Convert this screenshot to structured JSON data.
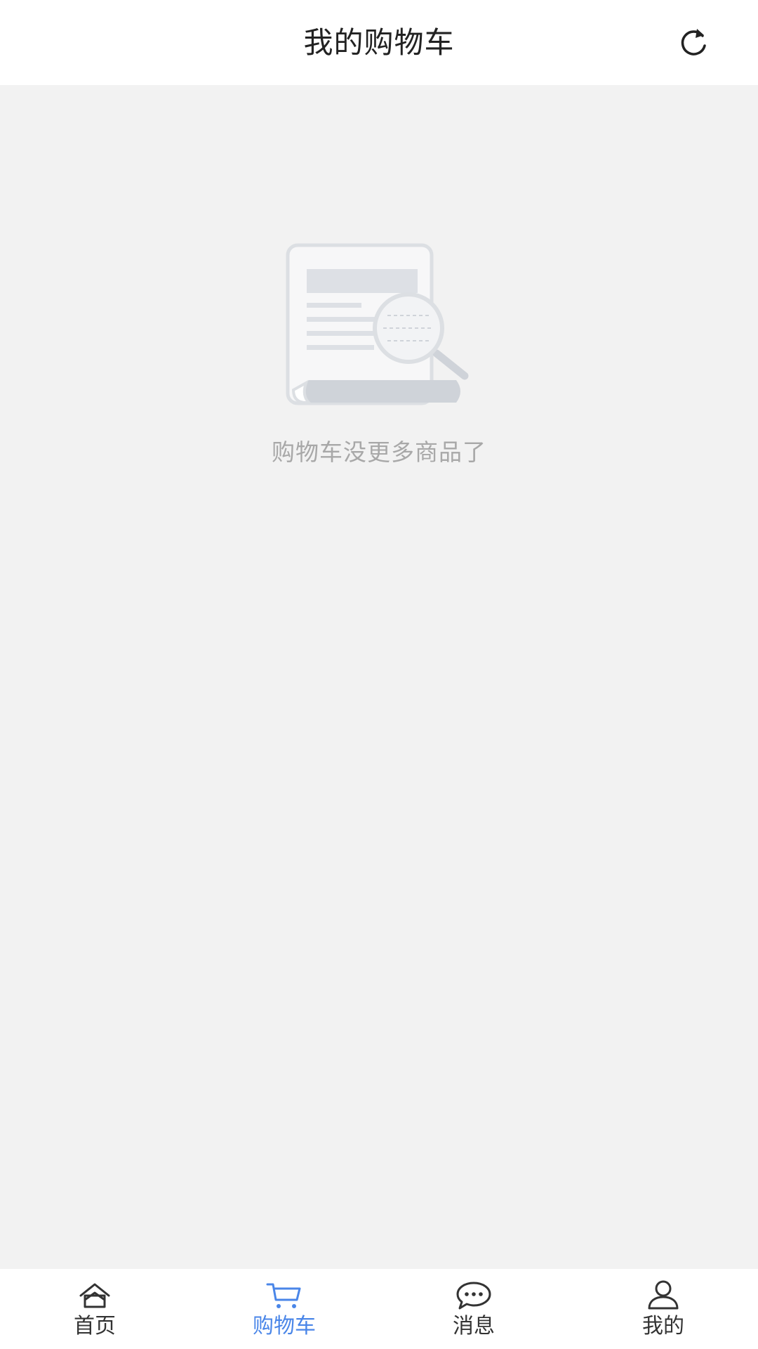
{
  "header": {
    "title": "我的购物车",
    "refresh_icon": "refresh-icon"
  },
  "empty_state": {
    "illustration_icon": "empty-document-search-icon",
    "message": "购物车没更多商品了"
  },
  "tabbar": {
    "active_color": "#4a86e8",
    "inactive_color": "#333333",
    "items": [
      {
        "label": "首页",
        "icon": "home-icon",
        "active": false
      },
      {
        "label": "购物车",
        "icon": "cart-icon",
        "active": true
      },
      {
        "label": "消息",
        "icon": "message-icon",
        "active": false
      },
      {
        "label": "我的",
        "icon": "user-icon",
        "active": false
      }
    ]
  }
}
